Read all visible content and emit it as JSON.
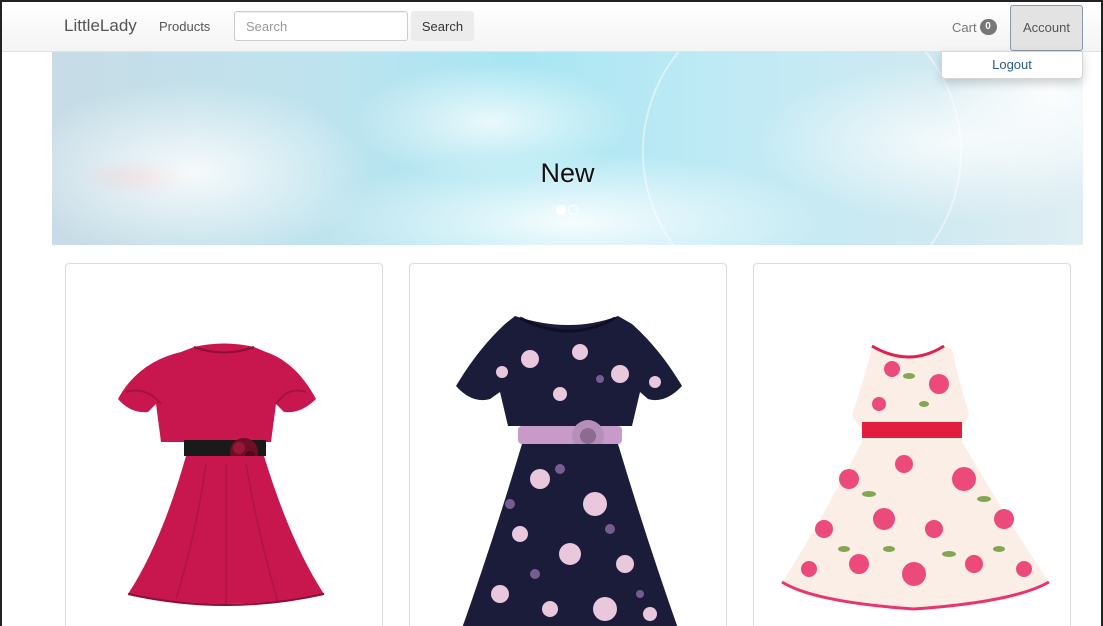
{
  "navbar": {
    "brand": "LittleLady",
    "products_label": "Products",
    "search_placeholder": "Search",
    "search_button": "Search",
    "cart_label": "Cart",
    "cart_count": "0",
    "account_label": "Account"
  },
  "account_menu": {
    "logout_label": "Logout"
  },
  "carousel": {
    "caption": "New",
    "slide_count": 2,
    "active_slide": 1
  },
  "products": [
    {
      "image": "pink-ruffle-dress",
      "color": "#c8174f"
    },
    {
      "image": "navy-floral-dress",
      "color": "#1b1b3a"
    },
    {
      "image": "rose-print-dress",
      "color": "#e8356e"
    }
  ],
  "colors": {
    "navbar_bg": "#f7f7f7",
    "link": "#2a5d8c",
    "badge": "#777777"
  }
}
